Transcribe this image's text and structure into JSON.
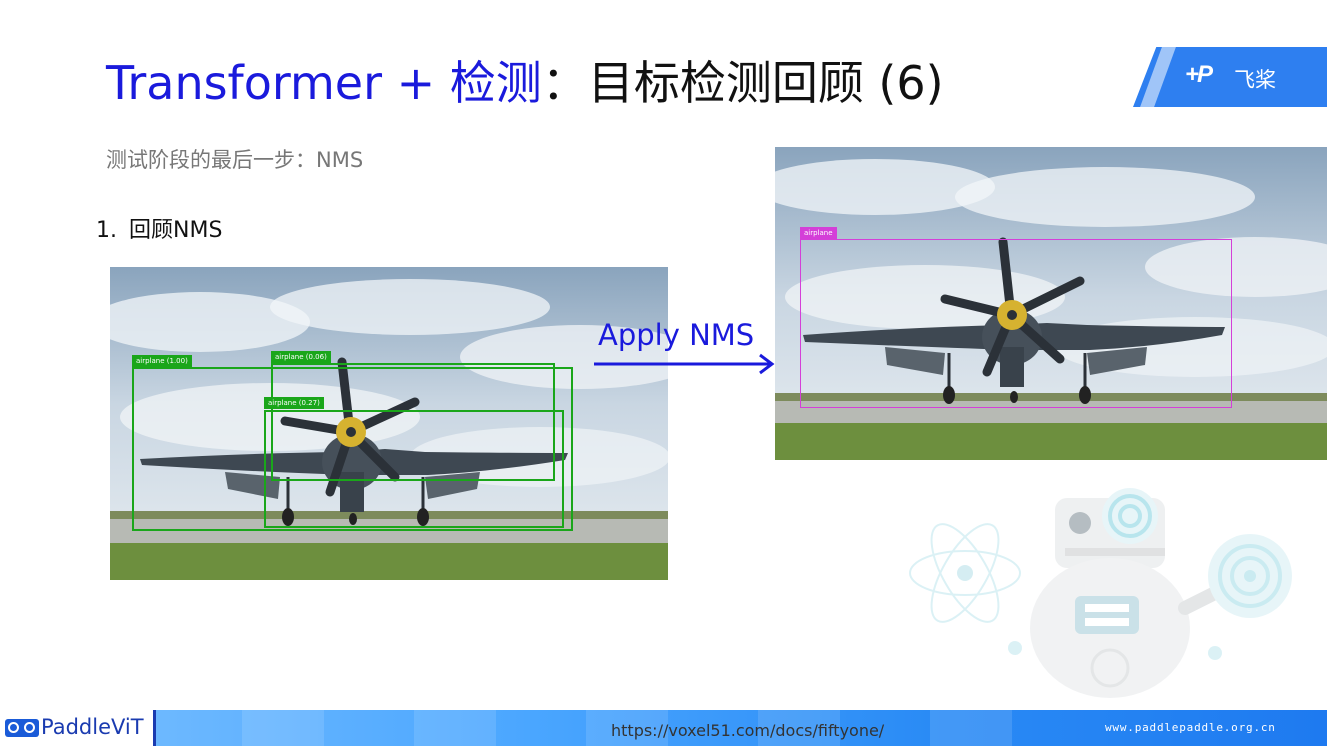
{
  "slide": {
    "title_highlight": "Transformer + 检测",
    "title_rest": "：目标检测回顾 (6)",
    "subtitle": "测试阶段的最后一步：NMS",
    "bullet_number": "1.",
    "bullet_text": "回顾NMS",
    "apply_label": "Apply NMS"
  },
  "logo": {
    "mark": "+P",
    "name": "飞桨"
  },
  "detections_before": [
    {
      "label": "airplane (1.00)"
    },
    {
      "label": "airplane (0.06)"
    },
    {
      "label": "airplane (0.27)"
    }
  ],
  "detections_after": [
    {
      "label": "airplane"
    }
  ],
  "footer": {
    "brand": "PaddleViT",
    "source_url": "https://voxel51.com/docs/fiftyone/",
    "website": "www.paddlepaddle.org.cn"
  },
  "colors": {
    "title_blue": "#1a1adc",
    "box_green": "#1aa61a",
    "box_magenta": "#d43fd8",
    "brand_blue": "#2e7ff0"
  }
}
